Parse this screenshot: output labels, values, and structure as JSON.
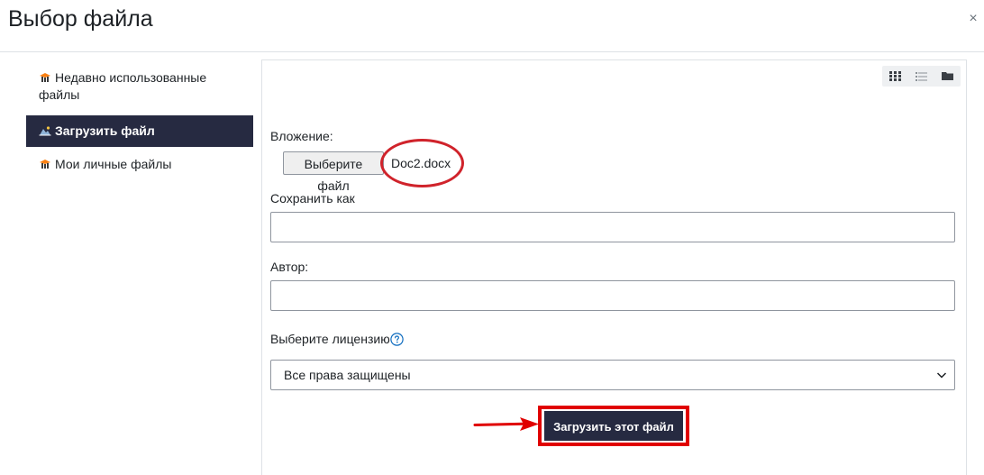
{
  "dialog": {
    "title": "Выбор файла",
    "close_glyph": "×"
  },
  "sidebar": {
    "items": [
      {
        "label": "Недавно использованные файлы",
        "icon": "moodle-hat-icon",
        "active": false
      },
      {
        "label": "Загрузить файл",
        "icon": "upload-icon",
        "active": true
      },
      {
        "label": "Мои личные файлы",
        "icon": "moodle-hat-icon",
        "active": false
      }
    ]
  },
  "view_toggle": {
    "buttons": [
      "grid-view-icon",
      "list-view-icon",
      "folder-view-icon"
    ],
    "active": "grid-view-icon"
  },
  "form": {
    "attachment_label": "Вложение:",
    "choose_file_button": "Выберите файл",
    "chosen_file_name": "Doc2.docx",
    "save_as_label": "Сохранить как",
    "save_as_value": "",
    "author_label": "Автор:",
    "author_value": "",
    "license_label": "Выберите лицензию",
    "license_selected": "Все права защищены",
    "upload_button": "Загрузить этот файл"
  },
  "colors": {
    "accent_dark": "#262a41",
    "annotation_red": "#d0232b",
    "highlight_red": "#e00000",
    "help_teal": "#0f6cbf"
  }
}
